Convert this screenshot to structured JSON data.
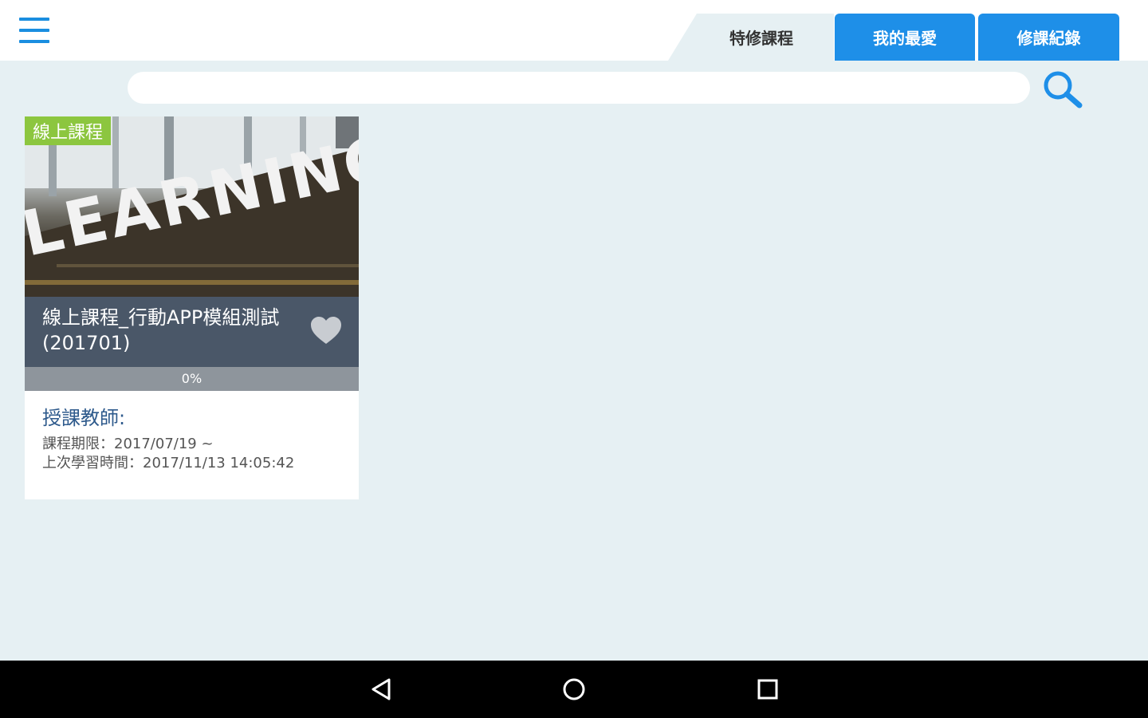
{
  "header": {
    "menu_icon": "hamburger-menu-icon",
    "tabs": [
      {
        "label": "特修課程",
        "active": true
      },
      {
        "label": "我的最愛",
        "active": false
      },
      {
        "label": "修課紀錄",
        "active": false
      }
    ]
  },
  "search": {
    "placeholder": "",
    "value": "",
    "icon": "search-icon"
  },
  "course_card": {
    "badge": "線上課程",
    "image_text": "LEARNING",
    "title": "線上課程_行動APP模組測試(201701)",
    "favorite_icon": "heart-icon",
    "progress_percent": 0,
    "progress_label": "0%",
    "teacher_label": "授課教師:",
    "period": "課程期限：2017/07/19 ~",
    "last_study": "上次學習時間：2017/11/13 14:05:42"
  },
  "navigation": {
    "back_icon": "back-triangle-icon",
    "home_icon": "home-circle-icon",
    "recent_icon": "recent-apps-square-icon"
  },
  "colors": {
    "accent": "#1e8fe8",
    "background": "#e6f0f3",
    "badge": "#8cc63f",
    "title_bar": "#4a5768",
    "progress_track": "#8e959c",
    "teacher_text": "#2e5a8c"
  }
}
